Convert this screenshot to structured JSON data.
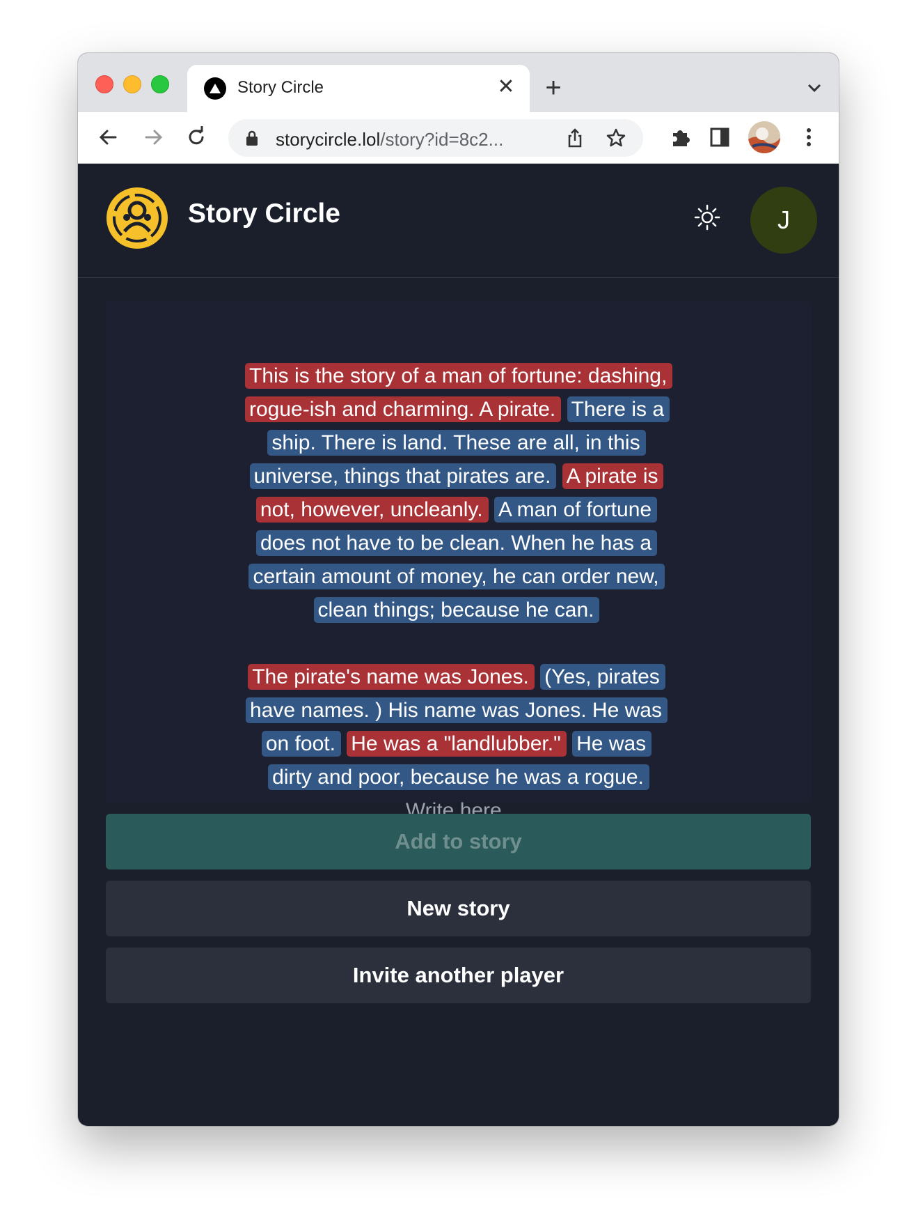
{
  "browser": {
    "tab_title": "Story Circle",
    "url_host": "storycircle.lol",
    "url_path": "/story?id=8c2...",
    "tab_close_glyph": "✕",
    "new_tab_glyph": "+"
  },
  "app": {
    "title": "Story Circle",
    "user_initial": "J",
    "accent_color": "#2a5a59",
    "red_author_color": "#a83236",
    "blue_author_color": "#345886"
  },
  "story": {
    "paragraphs": [
      [
        {
          "author": "red",
          "text": "This is the story of a man of fortune: dashing, rogue-ish and charming. A pirate."
        },
        {
          "author": "blue",
          "text": "There is a ship. There is land. These are all, in this universe, things that pirates are."
        },
        {
          "author": "red",
          "text": "A pirate is not, however, uncleanly."
        },
        {
          "author": "blue",
          "text": "A man of fortune does not have to be clean. When he has a certain amount of money, he can order new, clean things; because he can."
        }
      ],
      [
        {
          "author": "red",
          "text": "The pirate's name was Jones."
        },
        {
          "author": "blue",
          "text": "(Yes, pirates have names. ) His name was Jones. He was on foot."
        },
        {
          "author": "red",
          "text": "He was a \"landlubber.\""
        },
        {
          "author": "blue",
          "text": "He was dirty and poor, because he was a rogue."
        }
      ]
    ],
    "input_placeholder": "Write here."
  },
  "actions": {
    "add_label": "Add to story",
    "new_story_label": "New story",
    "invite_label": "Invite another player"
  },
  "icons": {
    "back": "arrow-left-icon",
    "forward": "arrow-right-icon",
    "reload": "reload-icon",
    "lock": "lock-icon",
    "share": "share-icon",
    "bookmark": "star-icon",
    "extensions": "puzzle-icon",
    "side_panel": "side-panel-icon",
    "menu": "kebab-menu-icon",
    "theme": "sun-icon"
  }
}
